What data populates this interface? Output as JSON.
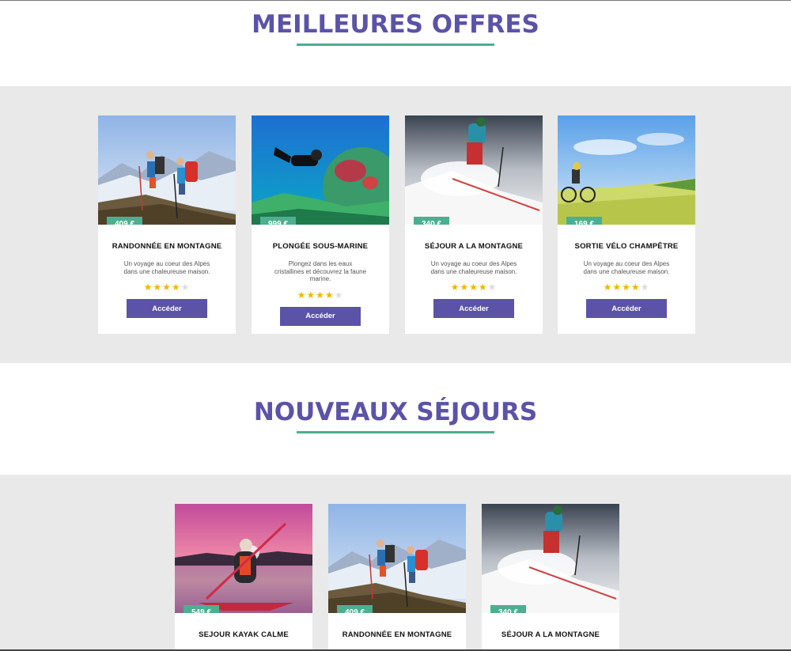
{
  "sections": [
    {
      "title": "MEILLEURES OFFRES",
      "cards": [
        {
          "price": "409 €",
          "title": "RANDONNÉE EN MONTAGNE",
          "desc": "Un voyage au coeur des Alpes dans une chaleureuse maison.",
          "rating": 4,
          "button": "Accéder",
          "image": "hikers-mountain"
        },
        {
          "price": "999 €",
          "title": "PLONGÉE SOUS-MARINE",
          "desc": "Plongez dans les eaux cristallines et découvrez la faune marine.",
          "rating": 4,
          "button": "Accéder",
          "image": "scuba-diver"
        },
        {
          "price": "340 €",
          "title": "SÉJOUR A LA MONTAGNE",
          "desc": "Un voyage au coeur des Alpes dans une chaleureuse maison.",
          "rating": 4,
          "button": "Accéder",
          "image": "skier"
        },
        {
          "price": "169 €",
          "title": "SORTIE VÉLO CHAMPÊTRE",
          "desc": "Un voyage au coeur des Alpes dans une chaleureuse maison.",
          "rating": 4,
          "button": "Accéder",
          "image": "cyclist-field"
        }
      ]
    },
    {
      "title": "NOUVEAUX SÉJOURS",
      "cards": [
        {
          "price": "549 €",
          "title": "SEJOUR KAYAK CALME",
          "image": "kayak-sunset"
        },
        {
          "price": "409 €",
          "title": "RANDONNÉE EN MONTAGNE",
          "image": "hikers-mountain"
        },
        {
          "price": "340 €",
          "title": "SÉJOUR A LA MONTAGNE",
          "image": "skier"
        }
      ]
    }
  ],
  "colors": {
    "accent": "#5b53a8",
    "green": "#4caf8f",
    "star": "#f5b400"
  },
  "max_rating": 5
}
